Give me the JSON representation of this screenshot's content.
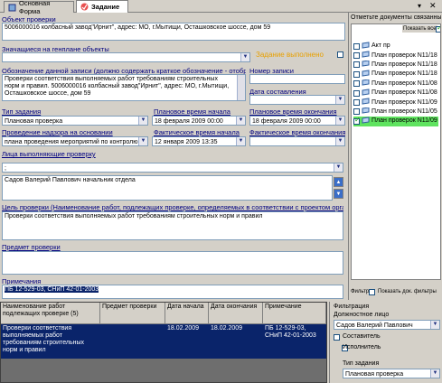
{
  "tabs": [
    "Основная Форма",
    "Задание"
  ],
  "labels": {
    "object": "Объект проверки",
    "plan_objects": "Значащиеся на генплане объекты",
    "task_done": "Задание выполнено",
    "designation": "Обозначение данной записи  (должно содержать краткое обозначение - отобра",
    "record_no": "Номер записи",
    "date_created": "Дата составления",
    "task_type": "Тип задания",
    "plan_start": "Плановое время начала",
    "plan_end": "Плановое время окончания",
    "basis": "Проведение надзора на основании",
    "fact_start": "Фактическое время начала",
    "fact_end": "Фактическое время окончания",
    "persons": "Лица выполняющие  проверку",
    "goal": "Цель проверки (Наименование работ, подлежащих проверке, определяемых в соответствии с проектом организ",
    "subject": "Предмет проверки",
    "notes": "Примечания"
  },
  "values": {
    "object": "5006000016  колбасный завод\"Ирнит\", адрес: МО, г.Мытищи, Осташковское шоссе, дом 59",
    "designation": "Проверки соответствия выполняемых работ требованиям строительных норм и правил. 5006000016  колбасный завод\"Ирнит\", адрес: МО, г.Мытищи, Осташковское шоссе, дом 59",
    "task_type": "Плановая проверка",
    "plan_start_date": "18 февраля 2009",
    "plan_start_time": "00:00",
    "plan_end_date": "18 февраля 2009",
    "plan_end_time": "00:00",
    "basis": "плана проведения мероприятий по контролю",
    "fact_start_date": "12  января  2009",
    "fact_start_time": "13:35",
    "persons_select": ";",
    "person": "Садов Валерий Павлович  начальник отдела",
    "goal": "Проверки соответствия выполняемых работ требованиям строительных норм и правил",
    "notes": "ПБ 12-529-03, СНиП 42-01-2003"
  },
  "right_panel": {
    "title": "Отметьте документы связанные",
    "show_all": "Показать все",
    "items": [
      {
        "label": "Акт пр",
        "checked": false
      },
      {
        "label": "План проверок N11/18",
        "checked": false
      },
      {
        "label": "План проверок N11/18",
        "checked": false
      },
      {
        "label": "План проверок N11/18",
        "checked": false
      },
      {
        "label": "План проверок N11/08",
        "checked": false
      },
      {
        "label": "План проверок N11/08",
        "checked": false
      },
      {
        "label": "План проверок N11/09",
        "checked": false
      },
      {
        "label": "План проверок N11/05",
        "checked": false
      },
      {
        "label": "План проверок N11/09",
        "checked": true
      }
    ],
    "filter": "Фильтр",
    "show_doc_filters": "Показать док. фильтры"
  },
  "grid": {
    "headers": [
      "Наименование работ подлежащих проверке (5)",
      "Предмет проверки",
      "Дата начала",
      "Дата окончания",
      "Примечание"
    ],
    "rows": [
      [
        "Проверки соответствия выполняемых работ требованиям строительных норм и правил",
        "",
        "18.02.2009",
        "18.02.2009",
        "ПБ 12-529-03, СНиП 42-01-2003"
      ]
    ]
  },
  "filter_panel": {
    "title": "Фильтрация",
    "official_label": "Должностное лицо",
    "official": "Садов Валерий Павлович",
    "composer": "Составитель",
    "executor": "Исполнитель",
    "task_type_label": "Тип задания",
    "task_type": "Плановая проверка"
  },
  "colors": {
    "accent": "#0a246a",
    "link": "#000080",
    "warn": "#e8a000"
  }
}
